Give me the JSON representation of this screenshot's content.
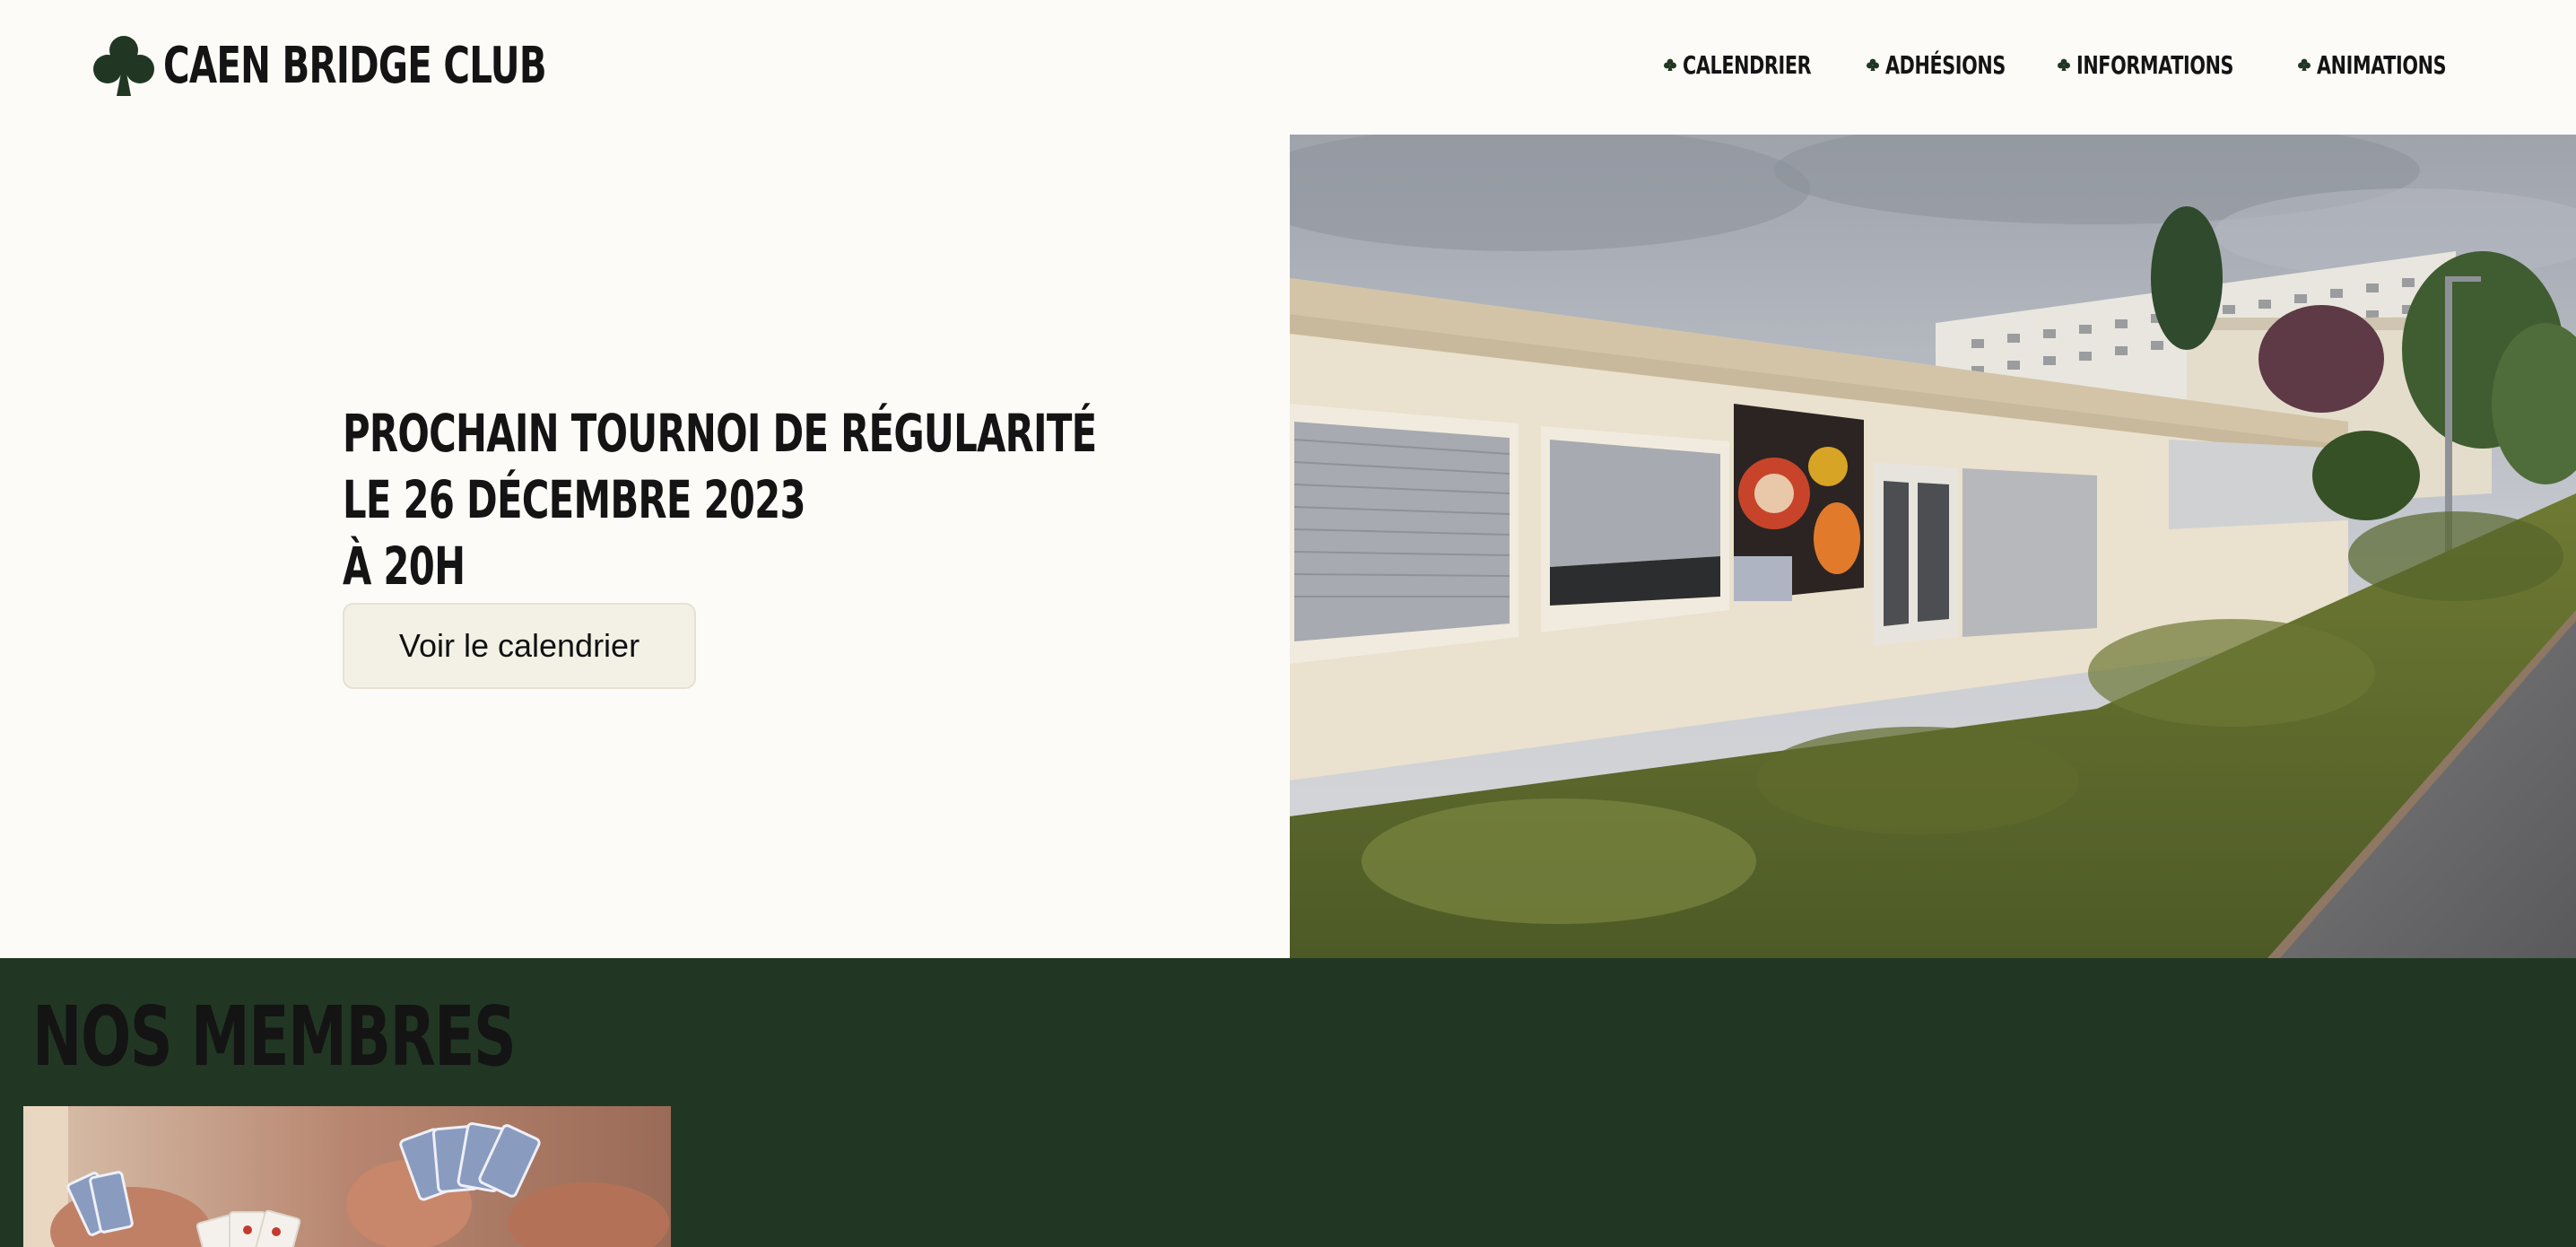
{
  "header": {
    "logo_text": "CAEN BRIDGE CLUB",
    "nav": [
      {
        "label": "CALENDRIER"
      },
      {
        "label": "ADHÉSIONS"
      },
      {
        "label": "INFORMATIONS"
      },
      {
        "label": "ANIMATIONS"
      }
    ]
  },
  "hero": {
    "lines": [
      "PROCHAIN TOURNOI DE RÉGULARITÉ",
      "LE 26 DÉCEMBRE 2023",
      "À 20H"
    ],
    "button_label": "Voir le calendrier"
  },
  "members": {
    "title": "NOS MEMBRES"
  },
  "colors": {
    "background": "#fcfbf8",
    "brand_green": "#213723",
    "text": "#141414",
    "button_bg": "#f3f0e6"
  }
}
